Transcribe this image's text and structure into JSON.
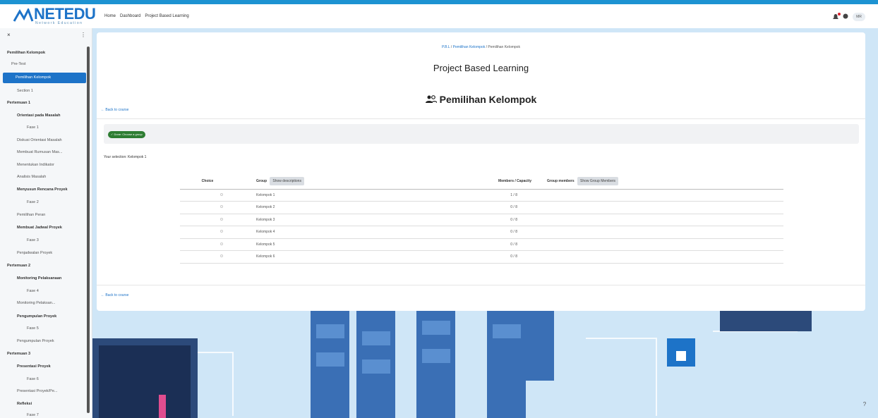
{
  "topbar": {
    "logo_text": "NETEDU",
    "logo_sub": "Network Education",
    "nav": [
      "Home",
      "Dashboard",
      "Project Based Learning"
    ],
    "avatar": "MR"
  },
  "sidebar": {
    "close": "×",
    "more": "⋮",
    "items": [
      {
        "label": "Pemilihan Kelompok",
        "bold": true
      },
      {
        "label": "Pre-Test"
      },
      {
        "label": "Pemilihan Kelompok",
        "active": true
      },
      {
        "label": "Section 1"
      },
      {
        "label": "Pertemuan 1"
      },
      {
        "label": "Orientasi pada Masalah",
        "bold": true
      },
      {
        "label": "Fase 1"
      },
      {
        "label": "Diskusi Orientasi Masalah"
      },
      {
        "label": "Membuat Rumusan Mas..."
      },
      {
        "label": "Menentukan Indikator"
      },
      {
        "label": "Analisis Masalah"
      },
      {
        "label": "Menyusun Rencana Proyek",
        "bold": true
      },
      {
        "label": "Fase 2"
      },
      {
        "label": "Pemilihan Peran"
      },
      {
        "label": "Membuat Jadwal Proyek",
        "bold": true
      },
      {
        "label": "Fase 3"
      },
      {
        "label": "Penjadwalan Proyek"
      },
      {
        "label": "Pertemuan 2"
      },
      {
        "label": "Monitoring Pelaksanaan",
        "bold": true
      },
      {
        "label": "Fase 4"
      },
      {
        "label": "Monitoring Pelaksan..."
      },
      {
        "label": "Pengumpulan Proyek",
        "bold": true
      },
      {
        "label": "Fase 5"
      },
      {
        "label": "Pengumpulan Proyek"
      },
      {
        "label": "Pertemuan 3"
      },
      {
        "label": "Presentasi Proyek",
        "bold": true
      },
      {
        "label": "Fase 6"
      },
      {
        "label": "Presentasi Proyek/Pe..."
      },
      {
        "label": "Refleksi",
        "bold": true
      },
      {
        "label": "Fase 7"
      }
    ]
  },
  "main": {
    "breadcrumb_link": "P.B.L",
    "breadcrumb_link2": "Pemilihan Kelompok",
    "breadcrumb_sep": "/",
    "breadcrumb_current": "Pemilihan Kelompok",
    "course_title": "Project Based Learning",
    "page_title": "Pemilihan Kelompok",
    "back_link": "Back to course",
    "status_label": "Done: Choose a group",
    "selection_text": "Your selection: Kelompok 1",
    "table": {
      "col_choice": "Choice",
      "col_group": "Group",
      "btn_descriptions": "Show descriptions",
      "col_capacity": "Members / Capacity",
      "col_members": "Group members",
      "btn_members": "Show Group Members",
      "rows": [
        {
          "group": "Kelompok 1",
          "capacity": "1 / 8"
        },
        {
          "group": "Kelompok 2",
          "capacity": "0 / 8"
        },
        {
          "group": "Kelompok 3",
          "capacity": "0 / 8"
        },
        {
          "group": "Kelompok 4",
          "capacity": "0 / 8"
        },
        {
          "group": "Kelompok 5",
          "capacity": "0 / 8"
        },
        {
          "group": "Kelompok 6",
          "capacity": "0 / 8"
        }
      ]
    }
  },
  "help": "?",
  "colors": {
    "brand": "#1d93d2",
    "link": "#1d73c8",
    "done": "#2e7d32"
  }
}
